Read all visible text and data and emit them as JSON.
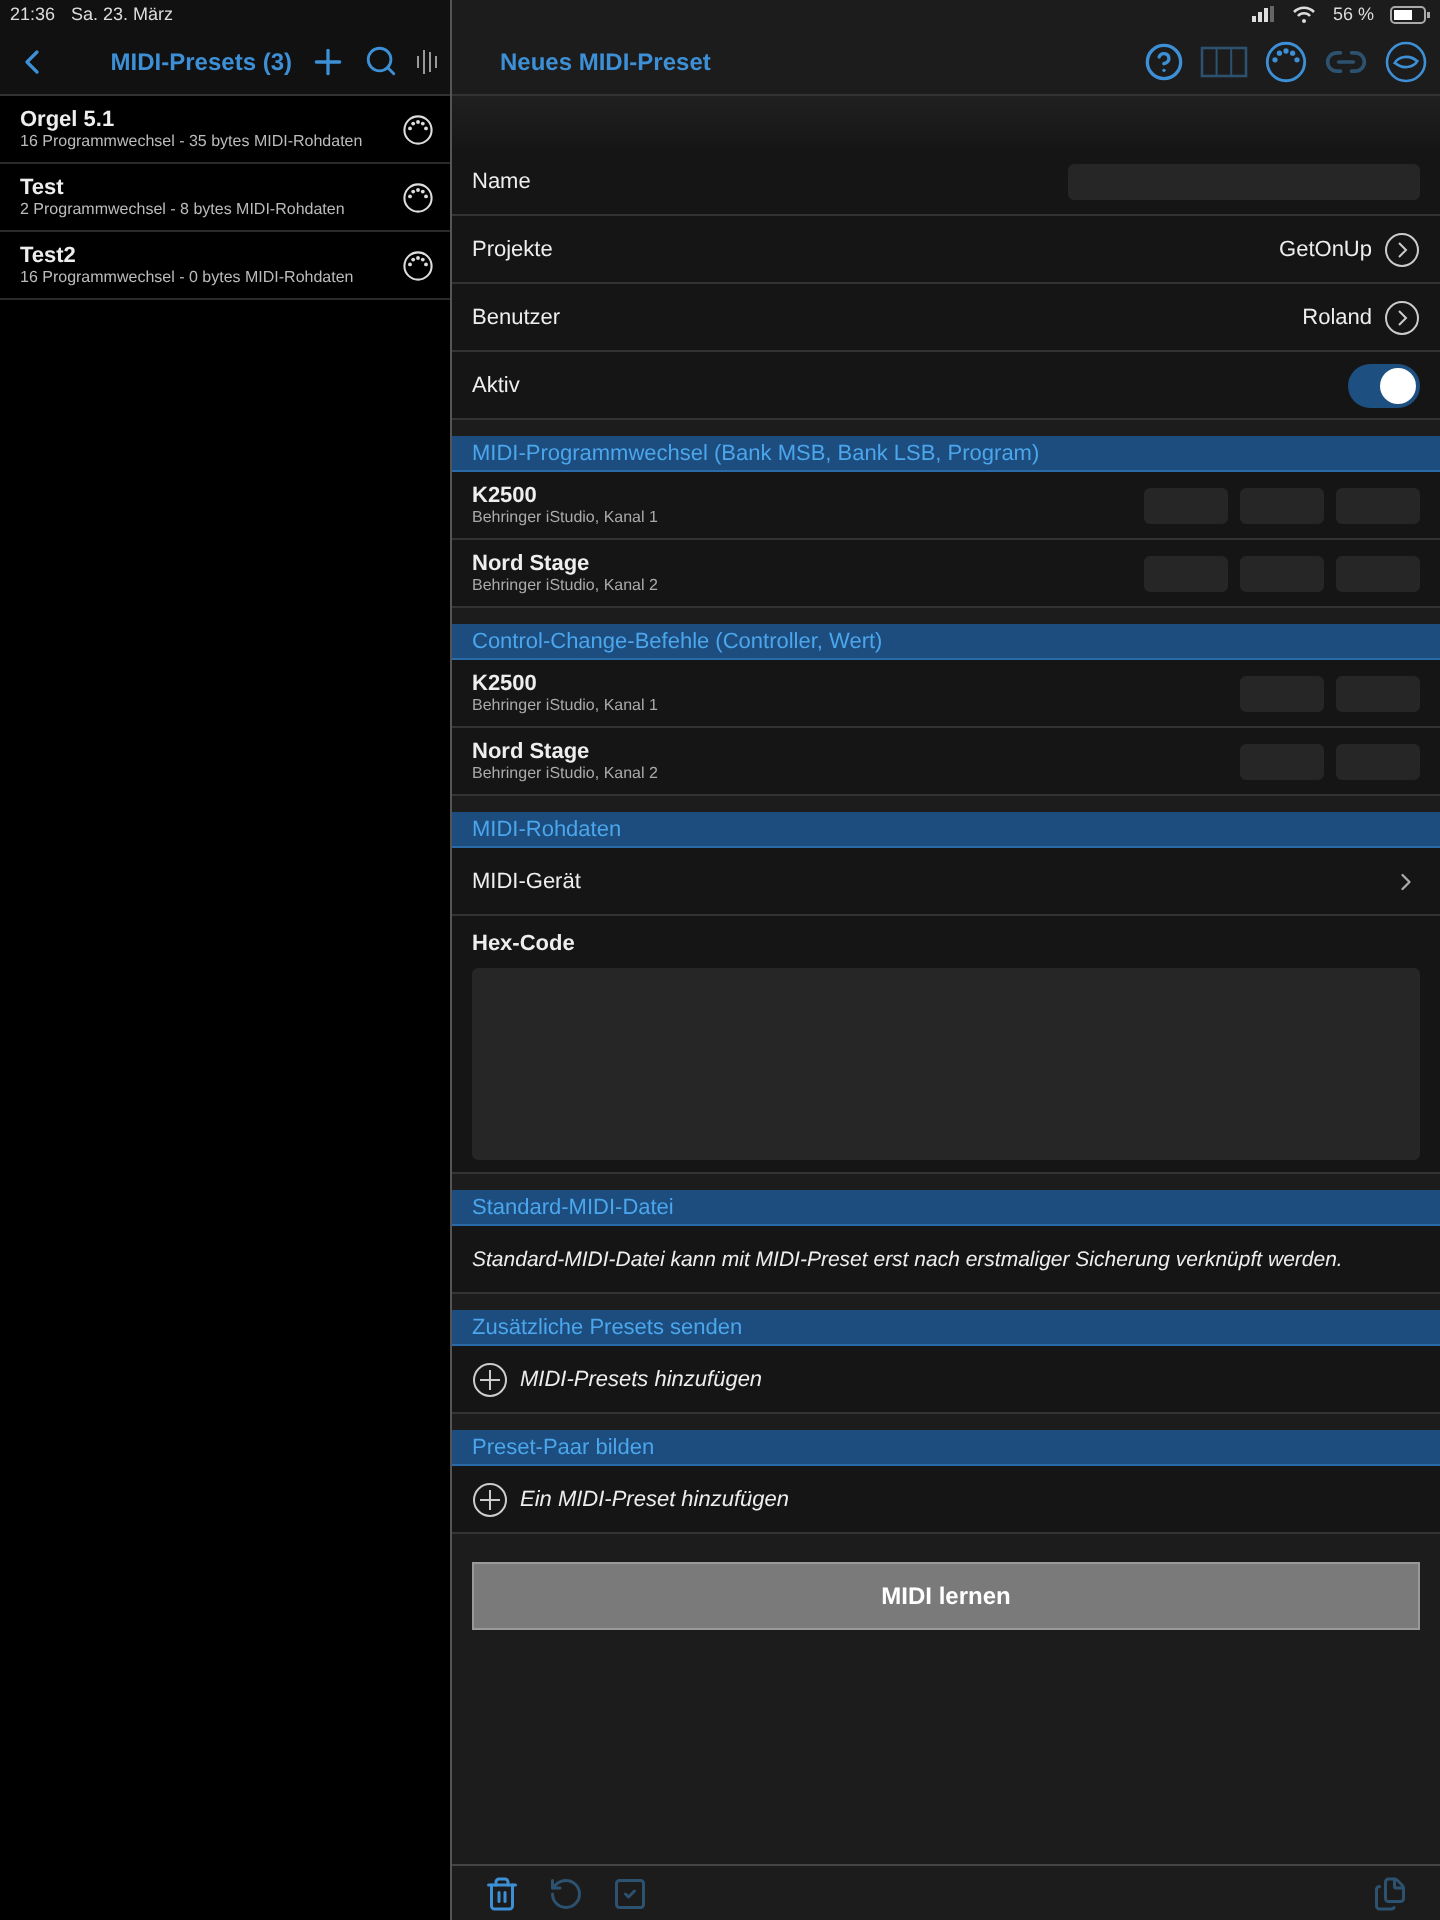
{
  "status_bar": {
    "time": "21:36",
    "date": "Sa. 23. März",
    "battery": "56 %"
  },
  "sidebar": {
    "title": "MIDI-Presets (3)",
    "items": [
      {
        "title": "Orgel 5.1",
        "subtitle": "16 Programmwechsel - 35 bytes MIDI-Rohdaten",
        "selected": false
      },
      {
        "title": "Test",
        "subtitle": "2 Programmwechsel - 8 bytes MIDI-Rohdaten",
        "selected": false
      },
      {
        "title": "Test2",
        "subtitle": "16 Programmwechsel - 0 bytes MIDI-Rohdaten",
        "selected": false
      }
    ]
  },
  "detail": {
    "title": "Neues MIDI-Preset",
    "toolbar": [
      {
        "kind": "help",
        "disabled": false
      },
      {
        "kind": "keyboard",
        "disabled": true
      },
      {
        "kind": "midi",
        "disabled": false
      },
      {
        "kind": "link",
        "disabled": true
      },
      {
        "kind": "sync",
        "disabled": false
      }
    ],
    "settings": [
      {
        "kind": "field",
        "label": "Name"
      },
      {
        "kind": "link",
        "label": "Projekte",
        "value": "GetOnUp"
      },
      {
        "kind": "link",
        "label": "Benutzer",
        "value": "Roland"
      },
      {
        "kind": "toggle",
        "label": "Aktiv",
        "on": true
      }
    ],
    "device_sections": [
      {
        "kind": "program_change",
        "header": "MIDI-Programmwechsel (Bank MSB, Bank LSB, Program)",
        "devices": [
          {
            "name": "K2500",
            "port": "Behringer iStudio, Kanal 1"
          },
          {
            "name": "Nord Stage",
            "port": "Behringer iStudio, Kanal 2"
          }
        ]
      },
      {
        "kind": "control_change",
        "header": "Control-Change-Befehle (Controller, Wert)",
        "devices": [
          {
            "name": "K2500",
            "port": "Behringer iStudio, Kanal 1"
          },
          {
            "name": "Nord Stage",
            "port": "Behringer iStudio, Kanal 2"
          }
        ]
      }
    ],
    "raw_data": {
      "header": "MIDI-Rohdaten",
      "device_label": "MIDI-Gerät",
      "hex_label": "Hex-Code"
    },
    "midi_file": {
      "header": "Standard-MIDI-Datei",
      "note": "Standard-MIDI-Datei kann mit MIDI-Preset erst nach erstmaliger Sicherung verknüpft werden."
    },
    "additional_presets": {
      "header": "Zusätzliche Presets senden",
      "action": "MIDI-Presets hinzufügen"
    },
    "preset_pair": {
      "header": "Preset-Paar bilden",
      "action": "Ein MIDI-Preset hinzufügen"
    },
    "learn_button": "MIDI lernen",
    "bottom_toolbar": [
      {
        "kind": "trash",
        "disabled": false
      },
      {
        "kind": "undo",
        "disabled": true
      },
      {
        "kind": "check",
        "disabled": true
      },
      {
        "kind": "copy",
        "disabled": true
      }
    ]
  }
}
